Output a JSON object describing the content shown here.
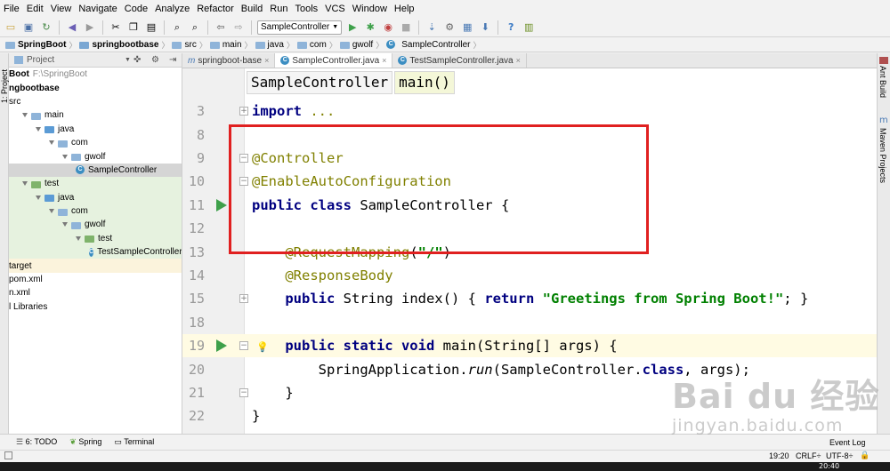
{
  "menubar": {
    "items": [
      "File",
      "Edit",
      "View",
      "Navigate",
      "Code",
      "Analyze",
      "Refactor",
      "Build",
      "Run",
      "Tools",
      "VCS",
      "Window",
      "Help"
    ]
  },
  "toolbar": {
    "run_config": "SampleController"
  },
  "navbar": {
    "crumbs": [
      "SpringBoot",
      "springbootbase",
      "src",
      "main",
      "java",
      "com",
      "gwolf",
      "SampleController"
    ]
  },
  "left_strip": {
    "label": "1: Project"
  },
  "project_panel": {
    "title": "Project",
    "root_name": "Boot",
    "root_path": "F:\\SpringBoot",
    "module": "ngbootbase",
    "tree": [
      {
        "label": "src",
        "indent": 0
      },
      {
        "label": "main",
        "indent": 1
      },
      {
        "label": "java",
        "indent": 2
      },
      {
        "label": "com",
        "indent": 3
      },
      {
        "label": "gwolf",
        "indent": 4
      },
      {
        "label": "SampleController",
        "indent": 5
      },
      {
        "label": "test",
        "indent": 1
      },
      {
        "label": "java",
        "indent": 2
      },
      {
        "label": "com",
        "indent": 3
      },
      {
        "label": "gwolf",
        "indent": 4
      },
      {
        "label": "test",
        "indent": 5
      },
      {
        "label": "TestSampleController",
        "indent": 6
      },
      {
        "label": "target",
        "indent": 0
      },
      {
        "label": "pom.xml",
        "indent": 0
      },
      {
        "label": "n.xml",
        "indent": 0
      },
      {
        "label": "l Libraries",
        "indent": 0
      }
    ]
  },
  "tabs": [
    {
      "icon": "m",
      "label": "springboot-base"
    },
    {
      "icon": "C",
      "label": "SampleController.java"
    },
    {
      "icon": "C",
      "label": "TestSampleController.java"
    }
  ],
  "editor": {
    "breadcrumb_class": "SampleController",
    "breadcrumb_method": "main()",
    "lines": [
      {
        "n": "3",
        "tokens": [
          {
            "t": "import",
            "c": "kw"
          },
          {
            "t": " ...",
            "c": "ann"
          }
        ]
      },
      {
        "n": "8",
        "tokens": []
      },
      {
        "n": "9",
        "tokens": [
          {
            "t": "@Controller",
            "c": "ann"
          }
        ]
      },
      {
        "n": "10",
        "tokens": [
          {
            "t": "@EnableAutoConfiguration",
            "c": "ann"
          }
        ]
      },
      {
        "n": "11",
        "tokens": [
          {
            "t": "public class",
            "c": "kw"
          },
          {
            "t": " SampleController {",
            "c": ""
          }
        ]
      },
      {
        "n": "12",
        "tokens": []
      },
      {
        "n": "13",
        "tokens": [
          {
            "t": "    @RequestMapping",
            "c": "ann"
          },
          {
            "t": "(",
            "c": ""
          },
          {
            "t": "\"/\"",
            "c": "str"
          },
          {
            "t": ")",
            "c": ""
          }
        ]
      },
      {
        "n": "14",
        "tokens": [
          {
            "t": "    @ResponseBody",
            "c": "ann"
          }
        ]
      },
      {
        "n": "15",
        "tokens": [
          {
            "t": "    public",
            "c": "kw"
          },
          {
            "t": " String index() { ",
            "c": ""
          },
          {
            "t": "return",
            "c": "kw"
          },
          {
            "t": " ",
            "c": ""
          },
          {
            "t": "\"Greetings from Spring Boot!\"",
            "c": "str"
          },
          {
            "t": "; }",
            "c": ""
          }
        ]
      },
      {
        "n": "18",
        "tokens": []
      },
      {
        "n": "19",
        "tokens": [
          {
            "t": "    public static void",
            "c": "kw"
          },
          {
            "t": " main(String[] args) {",
            "c": ""
          }
        ]
      },
      {
        "n": "20",
        "tokens": [
          {
            "t": "        SpringApplication.",
            "c": ""
          },
          {
            "t": "run",
            "c": "it"
          },
          {
            "t": "(SampleController.",
            "c": ""
          },
          {
            "t": "class",
            "c": "kw"
          },
          {
            "t": ", args);",
            "c": ""
          }
        ]
      },
      {
        "n": "21",
        "tokens": [
          {
            "t": "    }",
            "c": ""
          }
        ]
      },
      {
        "n": "22",
        "tokens": [
          {
            "t": "}",
            "c": ""
          }
        ]
      }
    ]
  },
  "right_strip": {
    "ant": "Ant Build",
    "maven": "Maven Projects"
  },
  "bottom_tools": {
    "todo": "6: TODO",
    "spring": "Spring",
    "terminal": "Terminal",
    "event_log": "Event Log"
  },
  "statusbar": {
    "position": "19:20",
    "line_sep": "CRLF÷",
    "encoding": "UTF-8÷"
  },
  "taskbar": {
    "clock": "20:40"
  },
  "watermark": {
    "brand": "Bai du 经验",
    "url": "jingyan.baidu.com"
  }
}
